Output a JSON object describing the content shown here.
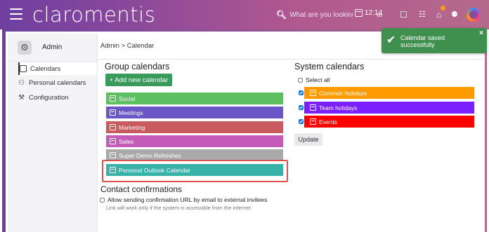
{
  "topbar": {
    "logo": "claromentis",
    "search_placeholder": "What are you looking fo",
    "time": "12:14"
  },
  "sidebar": {
    "title": "Admin",
    "items": [
      {
        "label": "Calendars",
        "active": true
      },
      {
        "label": "Personal calendars",
        "active": false
      },
      {
        "label": "Configuration",
        "active": false
      }
    ]
  },
  "breadcrumb": "Admin > Calendar",
  "group": {
    "title": "Group calendars",
    "add_label": "+ Add new calendar",
    "calendars": [
      {
        "name": "Social",
        "color": "#5cbf62"
      },
      {
        "name": "Meetings",
        "color": "#6a56c4"
      },
      {
        "name": "Marketing",
        "color": "#c95a5f"
      },
      {
        "name": "Sales",
        "color": "#c55bb8"
      },
      {
        "name": "Super Demo Refreshes",
        "color": "#a9a9a9"
      },
      {
        "name": "Personal Outlook Calendar",
        "color": "#38b2a8"
      }
    ]
  },
  "contact": {
    "title": "Contact confirmations",
    "checkbox_label": "Allow sending confirmation URL by email to external invitees",
    "hint": "Link will work only if the system is accessible from the internet."
  },
  "system": {
    "title": "System calendars",
    "select_all": "Select all",
    "calendars": [
      {
        "name": "Common holidays",
        "color": "#ff9a00",
        "checked": true
      },
      {
        "name": "Team holidays",
        "color": "#7a1fff",
        "checked": true
      },
      {
        "name": "Events",
        "color": "#ff0000",
        "checked": true
      }
    ],
    "update_label": "Update"
  },
  "toast": {
    "message": "Calendar saved successfully",
    "close": "×"
  }
}
